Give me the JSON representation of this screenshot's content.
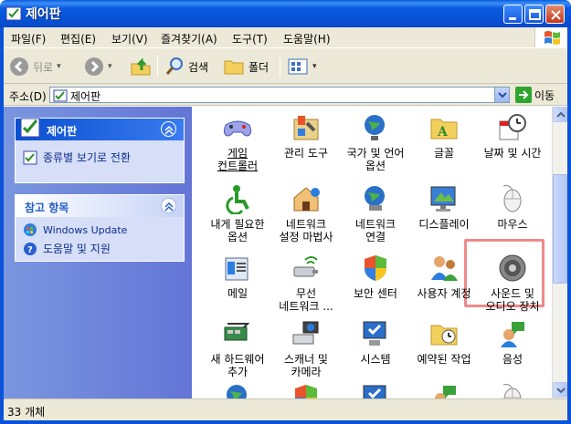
{
  "window": {
    "title": "제어판"
  },
  "menu": [
    "파일(F)",
    "편집(E)",
    "보기(V)",
    "즐겨찾기(A)",
    "도구(T)",
    "도움말(H)"
  ],
  "toolbar": {
    "back": "뒤로",
    "search": "검색",
    "folders": "폴더"
  },
  "address": {
    "label": "주소(D)",
    "value": "제어판",
    "go": "이동"
  },
  "sidepanel": {
    "control_panel": {
      "title": "제어판",
      "switch_view": "종류별 보기로 전환"
    },
    "see_also": {
      "title": "참고 항목",
      "links": [
        "Windows Update",
        "도움말 및 지원"
      ]
    }
  },
  "items": [
    {
      "label1": "게임",
      "label2": "컨트롤러",
      "icon": "game-controller-icon",
      "underline": true
    },
    {
      "label1": "관리 도구",
      "label2": "",
      "icon": "admin-tools-icon"
    },
    {
      "label1": "국가 및 언어",
      "label2": "옵션",
      "icon": "globe-clock-icon"
    },
    {
      "label1": "글꼴",
      "label2": "",
      "icon": "fonts-folder-icon"
    },
    {
      "label1": "날짜 및 시간",
      "label2": "",
      "icon": "date-time-icon"
    },
    {
      "label1": "내게 필요한",
      "label2": "옵션",
      "icon": "accessibility-icon"
    },
    {
      "label1": "네트워크",
      "label2": "설정 마법사",
      "icon": "network-house-icon"
    },
    {
      "label1": "네트워크",
      "label2": "연결",
      "icon": "network-globe-icon"
    },
    {
      "label1": "디스플레이",
      "label2": "",
      "icon": "display-icon"
    },
    {
      "label1": "마우스",
      "label2": "",
      "icon": "mouse-icon"
    },
    {
      "label1": "메일",
      "label2": "",
      "icon": "mail-icon"
    },
    {
      "label1": "무선",
      "label2": "네트워크 ...",
      "icon": "wireless-icon"
    },
    {
      "label1": "보안 센터",
      "label2": "",
      "icon": "security-shield-icon"
    },
    {
      "label1": "사용자 계정",
      "label2": "",
      "icon": "user-accounts-icon"
    },
    {
      "label1": "사운드 및",
      "label2": "오디오 장치",
      "icon": "speaker-icon"
    },
    {
      "label1": "새 하드웨어",
      "label2": "추가",
      "icon": "add-hardware-icon"
    },
    {
      "label1": "스캐너 및",
      "label2": "카메라",
      "icon": "scanner-camera-icon"
    },
    {
      "label1": "시스템",
      "label2": "",
      "icon": "system-icon"
    },
    {
      "label1": "예약된 작업",
      "label2": "",
      "icon": "scheduled-tasks-icon"
    },
    {
      "label1": "음성",
      "label2": "",
      "icon": "speech-icon"
    }
  ],
  "status": "33 개체"
}
